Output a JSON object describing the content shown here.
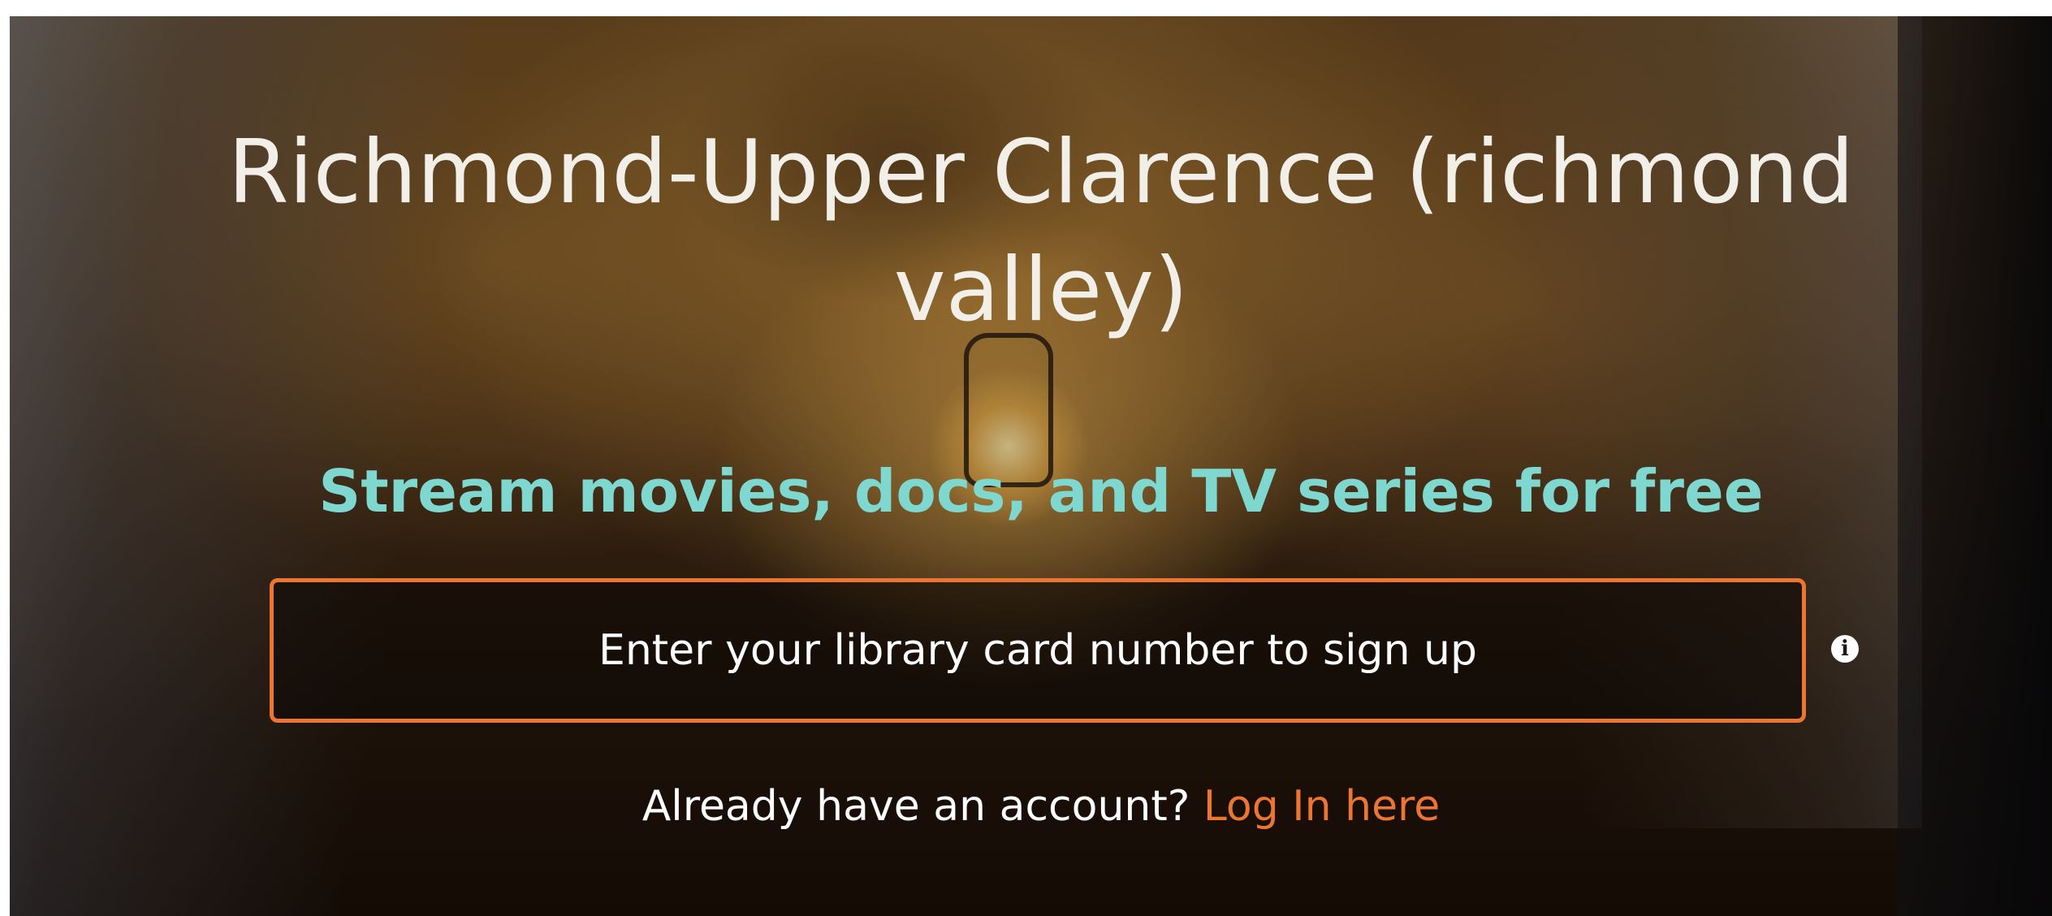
{
  "hero": {
    "title": "Richmond-Upper Clarence (richmond valley)",
    "tagline": "Stream movies, docs, and TV series for free"
  },
  "signup": {
    "card_placeholder": "Enter your library card number to sign up",
    "info_icon": "info-circle-icon"
  },
  "login": {
    "prompt": "Already have an account?",
    "link_label": "Log In here"
  },
  "colors": {
    "accent_orange": "#ec7531",
    "tagline_teal": "#7fd8d0",
    "title_white": "#f2efe9"
  }
}
